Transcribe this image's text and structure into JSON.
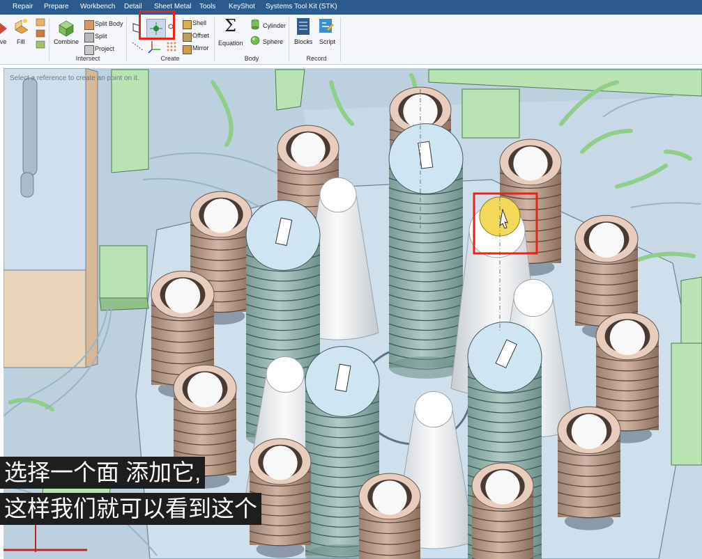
{
  "menubar": {
    "items": [
      "Repair",
      "Prepare",
      "Workbench",
      "Detail",
      "Sheet Metal",
      "Tools",
      "KeyShot",
      "Systems Tool Kit (STK)"
    ]
  },
  "ribbon": {
    "partial_left_label": "ve",
    "fill_label": "Fill",
    "combine_label": "Combine",
    "split_body_label": "Split Body",
    "split_label": "Split",
    "project_label": "Project",
    "intersect_group": "Intersect",
    "shell_label": "Shell",
    "offset_label": "Offset",
    "mirror_label": "Mirror",
    "create_group": "Create",
    "equation_label": "Equation",
    "cylinder_label": "Cylinder",
    "sphere_label": "Sphere",
    "body_group": "Body",
    "blocks_label": "Blocks",
    "script_label": "Script",
    "record_group": "Record"
  },
  "viewport": {
    "hint": "Select a reference to create an point on it."
  },
  "subtitles": {
    "line1": "选择一个面 添加它,",
    "line2": "这样我们就可以看到这个"
  },
  "colors": {
    "menubar": "#2b5a8e",
    "highlight": "#e8241a",
    "selected_face": "#f3d95a",
    "background": "#bcd0de"
  }
}
